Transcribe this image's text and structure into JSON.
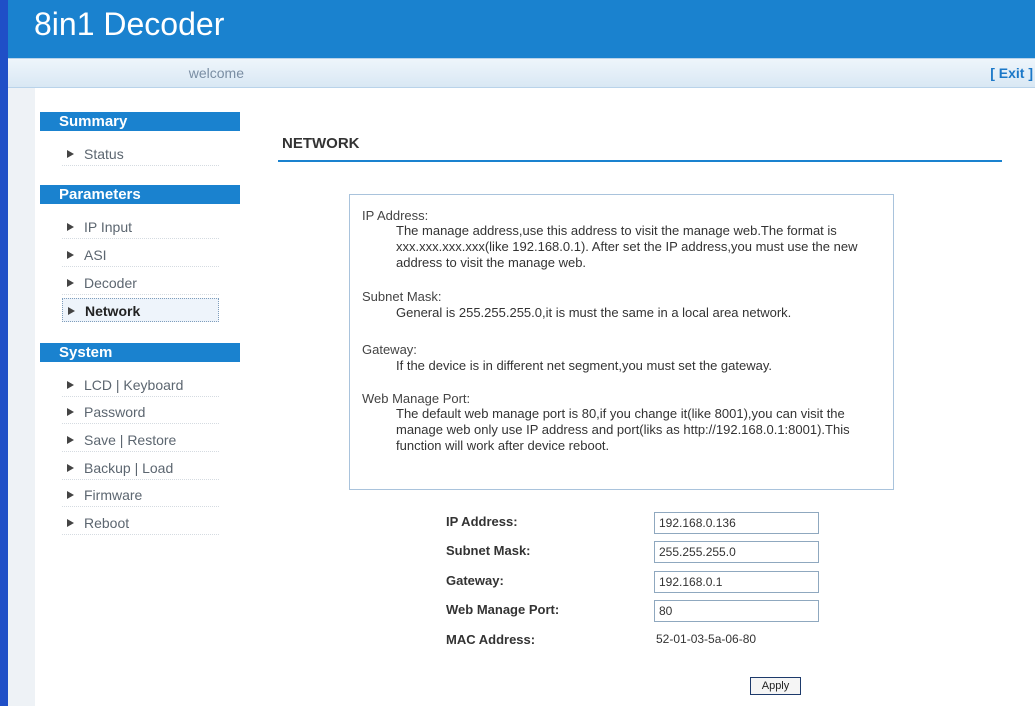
{
  "app": {
    "title": "8in1 Decoder"
  },
  "topbar": {
    "welcome_text": "welcome",
    "exit_label": "[ Exit ]"
  },
  "sidebar": {
    "summary": {
      "header": "Summary",
      "items": [
        "Status"
      ]
    },
    "parameters": {
      "header": "Parameters",
      "items": [
        "IP Input",
        "ASI",
        "Decoder",
        "Network"
      ]
    },
    "system": {
      "header": "System",
      "items": [
        "LCD | Keyboard",
        "Password",
        "Save | Restore",
        "Backup | Load",
        "Firmware",
        "Reboot"
      ]
    },
    "active_item": "Network"
  },
  "page": {
    "title": "NETWORK"
  },
  "help": {
    "ip_label": "IP Address:",
    "ip_text": "The manage address,use this address to visit the manage web.The format is xxx.xxx.xxx.xxx(like 192.168.0.1). After set the IP address,you must use the new address to visit the manage web.",
    "mask_label": "Subnet Mask:",
    "mask_text": "General is 255.255.255.0,it is must the same in a local area network.",
    "gateway_label": "Gateway:",
    "gateway_text": "If the device is in different net segment,you must set the gateway.",
    "port_label": "Web Manage Port:",
    "port_text": "The default web manage port is 80,if you change it(like 8001),you can visit the manage web only use IP address and port(liks as http://192.168.0.1:8001).This function will work after device reboot."
  },
  "form": {
    "ip_label": "IP Address:",
    "ip_value": "192.168.0.136",
    "mask_label": "Subnet Mask:",
    "mask_value": "255.255.255.0",
    "gateway_label": "Gateway:",
    "gateway_value": "192.168.0.1",
    "port_label": "Web Manage Port:",
    "port_value": "80",
    "mac_label": "MAC Address:",
    "mac_value": "52-01-03-5a-06-80",
    "apply_label": "Apply"
  },
  "colors": {
    "brand_blue": "#1a82cf",
    "left_edge": "#1f4fc7"
  }
}
